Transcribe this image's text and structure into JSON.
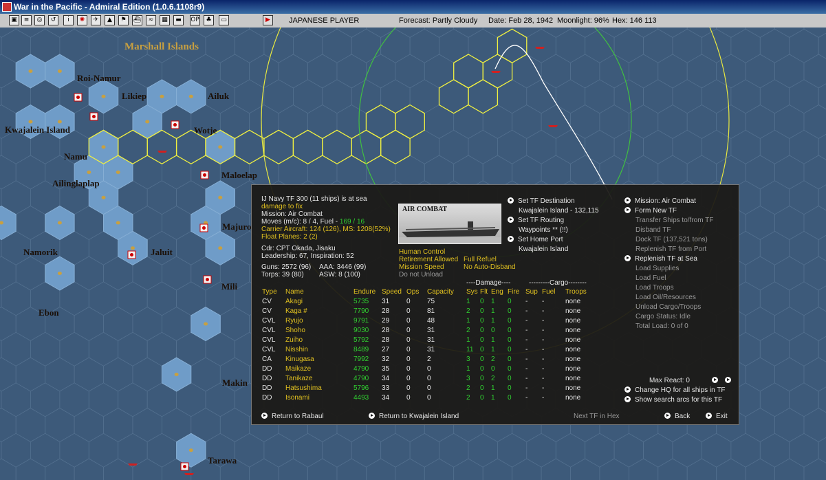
{
  "window": {
    "title": "War in the Pacific - Admiral Edition (1.0.6.1108r9)"
  },
  "toolbar": {
    "icons": [
      "save-icon",
      "load-icon",
      "end-turn-icon",
      "replay-icon",
      "info-icon",
      "rising-sun-icon",
      "plane-icon",
      "airfield-icon",
      "flag-icon",
      "ship-icon",
      "sub-icon",
      "base-icon",
      "tf-icon",
      "op-icon",
      "ground-icon",
      "map-icon",
      "play-icon"
    ]
  },
  "status": {
    "player": "JAPANESE PLAYER",
    "forecast": "Forecast: Partly Cloudy",
    "date": "Date: Feb 28, 1942",
    "moonlight": "Moonlight: 96%",
    "hex": "Hex: 146 113"
  },
  "places": {
    "marshall": "Marshall Islands",
    "roi": "Roi-Namur",
    "likiep": "Likiep",
    "ailuk": "Ailuk",
    "kwajalein": "Kwajalein Island",
    "wotje": "Wotje",
    "namu": "Namu",
    "maloelap": "Maloelap",
    "ailinglaplap": "Ailinglaplap",
    "majuro": "Majuro",
    "namorik": "Namorik",
    "jaluit": "Jaluit",
    "mili": "Mili",
    "ebon": "Ebon",
    "makin": "Makin",
    "tarawa": "Tarawa"
  },
  "tf": {
    "header": "IJ Navy TF 300 (11 ships) is at sea",
    "damage": "damage to fix",
    "mission": "Mission: Air Combat",
    "moves_label": "Moves (m/c): 8 / 4, Fuel - ",
    "fuel": "169 / 16",
    "carrier_aircraft": "Carrier Aircraft: 124 (126), MS: 1208(52%)",
    "float_planes": "Float Planes: 2 (2)",
    "cdr": "Cdr: CPT  Okada, Jisaku",
    "leadership": "Leadership: 67, Inspiration: 52",
    "guns": "Guns: 2572 (96)",
    "aaa": "AAA: 3446 (99)",
    "torps": "Torps: 39 (80)",
    "asw": "ASW: 8 (100)",
    "photo_caption": "AIR COMBAT",
    "human_control": "Human Control",
    "retirement": "Retirement Allowed",
    "full_refuel": "Full Refuel",
    "mission_speed": "Mission Speed",
    "no_auto_disband": "No Auto-Disband",
    "do_not_unload": "Do not Unload"
  },
  "middle_menu": {
    "set_destination": "Set TF Destination",
    "destination": "Kwajalein Island - 132,115",
    "set_routing": "Set TF Routing",
    "waypoints": "Waypoints ** (!!)",
    "set_home": "Set Home Port",
    "home": "Kwajalein Island"
  },
  "right_menu": {
    "mission": "Mission: Air Combat",
    "form_new": "Form New TF",
    "transfer": "Transfer Ships to/from TF",
    "disband": "Disband TF",
    "dock": "Dock TF (137,521 tons)",
    "replenish_port": "Replenish TF from Port",
    "replenish_sea": "Replenish TF at Sea",
    "load_supplies": "Load Supplies",
    "load_fuel": "Load Fuel",
    "load_troops": "Load Troops",
    "load_oil": "Load Oil/Resources",
    "unload": "Unload Cargo/Troops",
    "cargo_status": "Cargo Status: Idle",
    "total_load": "Total Load: 0 of 0",
    "max_react": "Max React:  0",
    "change_hq": "Change HQ for all ships in TF",
    "show_arcs": "Show search arcs for this TF"
  },
  "bottom": {
    "return_rabaul": "Return to Rabaul",
    "return_kwaj": "Return to Kwajalein Island",
    "next_tf": "Next TF in Hex",
    "back": "Back",
    "exit": "Exit"
  },
  "table": {
    "damage_group": "----Damage----",
    "cargo_group": "---------Cargo--------",
    "headers": [
      "Type",
      "Name",
      "Endure",
      "Speed",
      "Ops",
      "Capacity",
      "Sys",
      "Flt",
      "Eng",
      "Fire",
      "Sup",
      "Fuel",
      "Troops"
    ],
    "rows": [
      [
        "CV",
        "Akagi",
        "5735",
        "31",
        "0",
        "75",
        "1",
        "0",
        "1",
        "0",
        "-",
        "-",
        "none"
      ],
      [
        "CV",
        "Kaga #",
        "7790",
        "28",
        "0",
        "81",
        "2",
        "0",
        "1",
        "0",
        "-",
        "-",
        "none"
      ],
      [
        "CVL",
        "Ryujo",
        "9791",
        "29",
        "0",
        "48",
        "1",
        "0",
        "1",
        "0",
        "-",
        "-",
        "none"
      ],
      [
        "CVL",
        "Shoho",
        "9030",
        "28",
        "0",
        "31",
        "2",
        "0",
        "0",
        "0",
        "-",
        "-",
        "none"
      ],
      [
        "CVL",
        "Zuiho",
        "5792",
        "28",
        "0",
        "31",
        "1",
        "0",
        "1",
        "0",
        "-",
        "-",
        "none"
      ],
      [
        "CVL",
        "Nisshin",
        "8489",
        "27",
        "0",
        "31",
        "11",
        "0",
        "1",
        "0",
        "-",
        "-",
        "none"
      ],
      [
        "CA",
        "Kinugasa",
        "7992",
        "32",
        "0",
        "2",
        "3",
        "0",
        "2",
        "0",
        "-",
        "-",
        "none"
      ],
      [
        "DD",
        "Maikaze",
        "4790",
        "35",
        "0",
        "0",
        "1",
        "0",
        "0",
        "0",
        "-",
        "-",
        "none"
      ],
      [
        "DD",
        "Tanikaze",
        "4790",
        "34",
        "0",
        "0",
        "3",
        "0",
        "2",
        "0",
        "-",
        "-",
        "none"
      ],
      [
        "DD",
        "Hatsushima",
        "5796",
        "33",
        "0",
        "0",
        "2",
        "0",
        "1",
        "0",
        "-",
        "-",
        "none"
      ],
      [
        "DD",
        "Isonami",
        "4493",
        "34",
        "0",
        "0",
        "2",
        "0",
        "1",
        "0",
        "-",
        "-",
        "none"
      ]
    ]
  }
}
